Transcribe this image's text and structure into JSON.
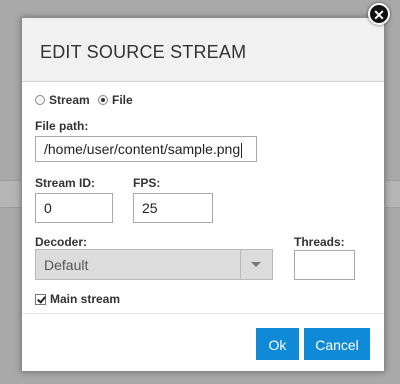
{
  "dialog": {
    "title": "EDIT SOURCE STREAM",
    "close_icon": "close-icon",
    "source_type": {
      "options": [
        {
          "label": "Stream",
          "checked": false
        },
        {
          "label": "File",
          "checked": true
        }
      ]
    },
    "file_path": {
      "label": "File path:",
      "value": "/home/user/content/sample.png"
    },
    "stream_id": {
      "label": "Stream ID:",
      "value": "0"
    },
    "fps": {
      "label": "FPS:",
      "value": "25"
    },
    "decoder": {
      "label": "Decoder:",
      "selected": "Default",
      "arrow_icon": "chevron-down-icon"
    },
    "threads": {
      "label": "Threads:",
      "value": ""
    },
    "main_stream": {
      "label": "Main stream",
      "checked": true
    },
    "buttons": {
      "ok": "Ok",
      "cancel": "Cancel"
    }
  },
  "colors": {
    "overlay": "#a9a9a9",
    "header_bg": "#f1f1f1",
    "primary_button": "#0f8ad6",
    "select_bg": "#dcdcdc"
  }
}
